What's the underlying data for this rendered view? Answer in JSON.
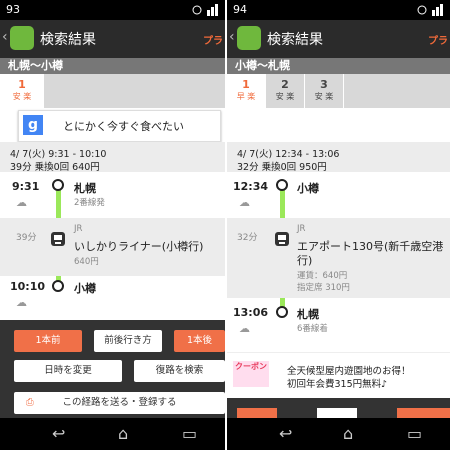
{
  "left": {
    "status_time": "93",
    "title": "検索結果",
    "plan_label": "プラ",
    "route": "札幌〜小樽",
    "tabs": [
      {
        "num": "1",
        "badge": "安 楽"
      }
    ],
    "ad_text": "とにかく今すぐ食べたい",
    "summary_line1": "4/ 7(火)  9:31 - 10:10",
    "summary_line2": "39分 乗換0回 640円",
    "dep_time": "9:31",
    "dep_station": "札幌",
    "dep_platform": "2番線発",
    "ride_duration": "39分",
    "train_name": "いしかりライナー(小樽行)",
    "fare": "640円",
    "arr_time": "10:10",
    "arr_station": "小樽",
    "buttons": {
      "prev": "1本前",
      "around": "前後行き方",
      "next": "1本後",
      "change_date": "日時を変更",
      "return_search": "復路を検索",
      "send_register": "この経路を送る・登録する"
    }
  },
  "right": {
    "status_time": "94",
    "title": "検索結果",
    "plan_label": "プラ",
    "route": "小樽〜札幌",
    "tabs": [
      {
        "num": "1",
        "badge": "早  楽"
      },
      {
        "num": "2",
        "badge": "安 楽"
      },
      {
        "num": "3",
        "badge": "安 楽"
      }
    ],
    "summary_line1": "4/ 7(火)  12:34 - 13:06",
    "summary_line2": "32分 乗換0回 950円",
    "dep_time": "12:34",
    "dep_station": "小樽",
    "ride_duration": "32分",
    "jr_label": "JR",
    "train_name_1": "エアポート130号(新千歳空港",
    "train_name_2": "行)",
    "fare_label": "運賃：640円",
    "reserved_label": "指定席 310円",
    "arr_time": "13:06",
    "arr_station": "札幌",
    "arr_platform": "6番線着",
    "coupon_label": "クーポン",
    "coupon_line1": "全天候型屋内遊園地のお得！",
    "coupon_line2": "初回年会費315円無料♪"
  },
  "left_jr_label": "JR",
  "colors": {
    "accent": "#f07048",
    "line": "#9be85a",
    "brand": "#6fb83d"
  }
}
